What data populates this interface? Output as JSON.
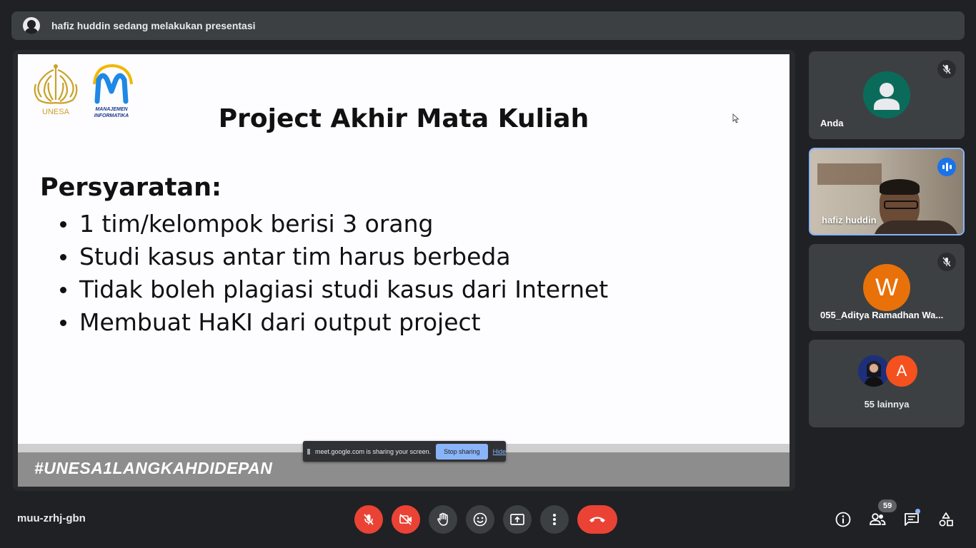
{
  "banner": {
    "text": "hafiz huddin sedang melakukan presentasi"
  },
  "slide": {
    "title": "Project Akhir Mata Kuliah",
    "heading": "Persyaratan:",
    "items": [
      "1 tim/kelompok berisi 3 orang",
      "Studi kasus antar tim harus berbeda",
      "Tidak boleh plagiasi studi kasus dari Internet",
      "Membuat HaKI dari output project"
    ],
    "footer_tag": "#UNESA1LANGKAHDIDEPAN",
    "logo_unesa_text": "UNESA",
    "logo_mi_text_1": "MANAJEMEN",
    "logo_mi_text_2": "INFORMATIKA"
  },
  "share_bar": {
    "text": "meet.google.com is sharing your screen.",
    "stop_label": "Stop sharing",
    "hide_label": "Hide"
  },
  "participants": {
    "you": {
      "name": "Anda",
      "muted": true,
      "avatar_color": "#0b6b5a"
    },
    "presenter": {
      "name": "hafiz huddin",
      "speaking": true
    },
    "third": {
      "name": "055_Aditya Ramadhan Wa...",
      "initial": "W",
      "muted": true,
      "avatar_color": "#e8710a"
    },
    "more": {
      "label": "55 lainnya",
      "initial": "A",
      "avatar_color": "#f4511e"
    }
  },
  "bottom_bar": {
    "meeting_code": "muu-zrhj-gbn",
    "participant_count": "59"
  },
  "colors": {
    "background": "#202124",
    "tile": "#3c4043",
    "danger": "#ea4335",
    "accent": "#8ab4f8"
  }
}
